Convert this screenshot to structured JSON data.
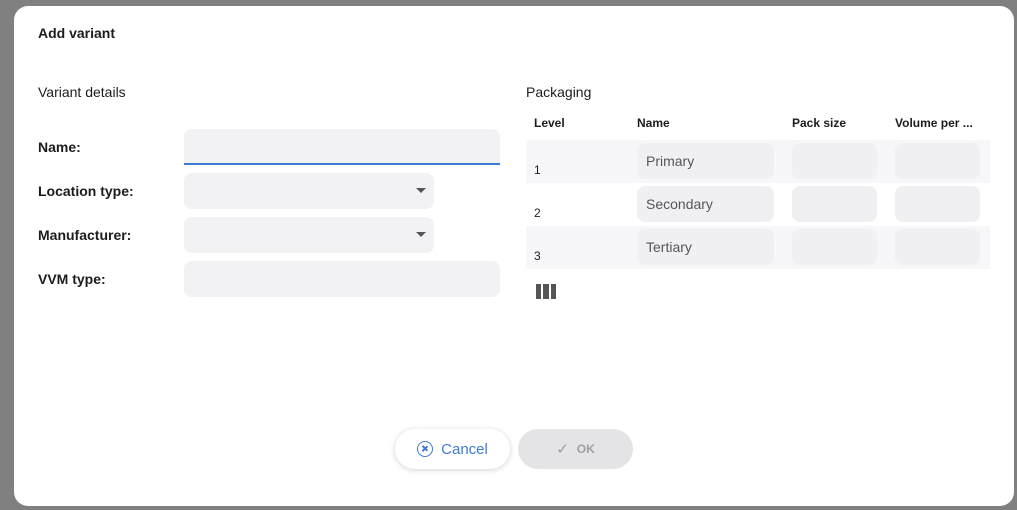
{
  "dialog": {
    "title": "Add variant"
  },
  "details": {
    "title": "Variant details",
    "fields": [
      {
        "label": "Name:",
        "value": ""
      },
      {
        "label": "Location type:",
        "value": ""
      },
      {
        "label": "Manufacturer:",
        "value": ""
      },
      {
        "label": "VVM type:",
        "value": ""
      }
    ]
  },
  "packaging": {
    "title": "Packaging",
    "columns": [
      "Level",
      "Name",
      "Pack size",
      "Volume per ..."
    ],
    "rows": [
      {
        "level": "1",
        "name": "Primary",
        "pack_size": "",
        "volume": ""
      },
      {
        "level": "2",
        "name": "Secondary",
        "pack_size": "",
        "volume": ""
      },
      {
        "level": "3",
        "name": "Tertiary",
        "pack_size": "",
        "volume": ""
      }
    ]
  },
  "actions": {
    "cancel_label": "Cancel",
    "ok_label": "OK"
  },
  "colors": {
    "accent": "#3e7bd6",
    "field_bg": "#f2f2f4",
    "disabled_bg": "#e4e4e6"
  },
  "icons": {
    "cancel": "cancel-circle-icon",
    "ok": "checkmark-icon",
    "columns": "columns-icon",
    "dropdown": "caret-down-icon"
  }
}
